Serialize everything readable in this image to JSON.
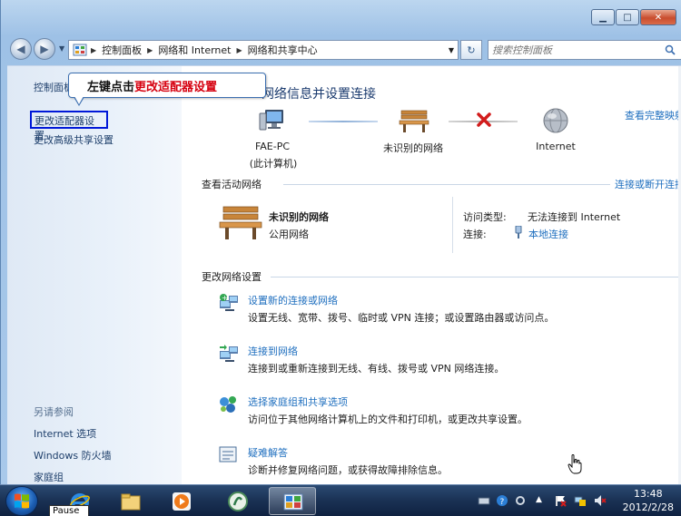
{
  "address_bar": {
    "crumbs": [
      "控制面板",
      "网络和 Internet",
      "网络和共享中心"
    ],
    "search_placeholder": "搜索控制面板"
  },
  "sidebar": {
    "home": "控制面板主页",
    "adapter": "更改适配器设置",
    "advanced_share": "更改高级共享设置",
    "see_also": "另请参阅",
    "internet_options": "Internet 选项",
    "firewall": "Windows 防火墙",
    "homegroup": "家庭组"
  },
  "callout": {
    "prefix": "左键点击",
    "highlight": "更改适配器设置"
  },
  "main": {
    "title_visible": "网络信息并设置连接",
    "view_full_map": "查看完整映射",
    "nodes": {
      "pc_name": "FAE-PC",
      "pc_sub": "(此计算机)",
      "network": "未识别的网络",
      "internet": "Internet"
    },
    "active_header": "查看活动网络",
    "connect_disconnect": "连接或断开连接",
    "active_network": {
      "name": "未识别的网络",
      "type": "公用网络",
      "access_type_label": "访问类型:",
      "access_type_value": "无法连接到 Internet",
      "connection_label": "连接:",
      "connection_value": "本地连接"
    },
    "change_header": "更改网络设置",
    "tasks": [
      {
        "link": "设置新的连接或网络",
        "desc": "设置无线、宽带、拨号、临时或 VPN 连接；或设置路由器或访问点。"
      },
      {
        "link": "连接到网络",
        "desc": "连接到或重新连接到无线、有线、拨号或 VPN 网络连接。"
      },
      {
        "link": "选择家庭组和共享选项",
        "desc": "访问位于其他网络计算机上的文件和打印机，或更改共享设置。"
      },
      {
        "link": "疑难解答",
        "desc": "诊断并修复网络问题，或获得故障排除信息。"
      }
    ]
  },
  "taskbar": {
    "tooltip": "Pause",
    "time": "13:48",
    "date": "2012/2/28"
  },
  "colors": {
    "link": "#1f6fbf",
    "highlight_border": "#0018d8",
    "callout_red": "#d6000f"
  }
}
